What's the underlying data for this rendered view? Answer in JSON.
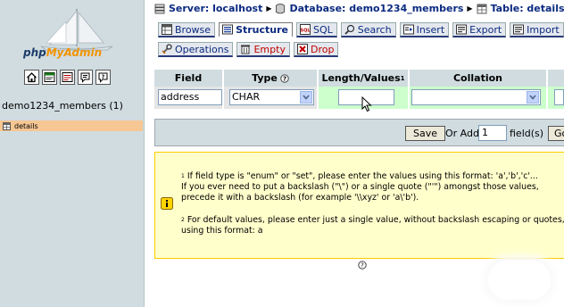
{
  "app": {
    "logo_text_1": "php",
    "logo_text_2": "MyAdmin"
  },
  "sidebar": {
    "icons": [
      "home-icon",
      "sql-window-icon",
      "sql-query-icon",
      "docs-icon",
      "help-icon"
    ],
    "database_title": "demo1234_members (1)",
    "tables": [
      {
        "name": "details"
      }
    ]
  },
  "breadcrumb": {
    "server": "Server: localhost",
    "database": "Database: demo1234_members",
    "table": "Table: details"
  },
  "tabs": {
    "row1": [
      {
        "label": "Browse",
        "icon": "browse-icon"
      },
      {
        "label": "Structure",
        "icon": "structure-icon",
        "active": true
      },
      {
        "label": "SQL",
        "icon": "sql-icon"
      },
      {
        "label": "Search",
        "icon": "search-icon"
      },
      {
        "label": "Insert",
        "icon": "insert-icon"
      },
      {
        "label": "Export",
        "icon": "export-icon"
      },
      {
        "label": "Import",
        "icon": "import-icon"
      }
    ],
    "row2": [
      {
        "label": "Operations",
        "icon": "operations-icon"
      },
      {
        "label": "Empty",
        "icon": "empty-icon"
      },
      {
        "label": "Drop",
        "icon": "drop-icon"
      }
    ]
  },
  "field_table": {
    "headers": {
      "field": "Field",
      "type": "Type",
      "length": "Length/Values",
      "length_note": "1",
      "collation": "Collation"
    },
    "row": {
      "field": "address",
      "type": "CHAR",
      "length": "",
      "collation": ""
    }
  },
  "save_bar": {
    "save": "Save",
    "or_add": "Or Add",
    "add_count": "1",
    "fields": "field(s)",
    "go": "Go"
  },
  "notice": {
    "note1_num": "1",
    "note1_lines": [
      "If field type is \"enum\" or \"set\", please enter the values using this format: 'a','b','c'...",
      "If you ever need to put a backslash (\"\\\") or a single quote (\"'\") amongst those values,",
      "precede it with a backslash (for example '\\\\xyz' or 'a\\'b')."
    ],
    "note2_num": "2",
    "note2_lines": [
      "For default values, please enter just a single value, without backslash escaping or quotes,",
      "using this format: a"
    ]
  },
  "colors": {
    "sidebar_bg": "#d0dce0",
    "highlight_row": "#f6c693",
    "notice_bg": "#ffffcc",
    "link": "#0b2a80",
    "danger": "#c00000"
  }
}
